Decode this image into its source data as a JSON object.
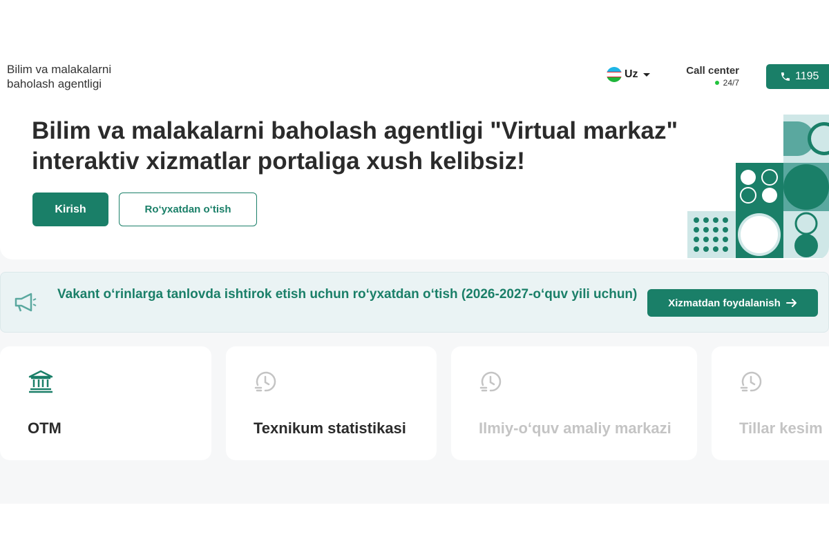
{
  "header": {
    "brand_line1": "Bilim va malakalarni",
    "brand_line2": "baholash agentligi",
    "language": "Uz",
    "call_center_title": "Call center",
    "call_center_hours": "24/7",
    "phone_number": "1195"
  },
  "hero": {
    "title_line1": "Bilim va malakalarni baholash agentligi \"Virtual markaz\"",
    "title_line2": "interaktiv xizmatlar portaliga xush kelibsiz!",
    "login_label": "Kirish",
    "register_label": "Ro‘yxatdan o‘tish"
  },
  "banner": {
    "text": "Vakant o‘rinlarga tanlovda ishtirok etish uchun ro‘yxatdan o‘tish (2026-2027-o‘quv yili uchun)",
    "button_label": "Xizmatdan foydalanish",
    "icon": "megaphone-icon"
  },
  "cards": [
    {
      "label": "OTM",
      "icon": "university-building-icon",
      "state": "active"
    },
    {
      "label": "Texnikum statistikasi",
      "icon": "clock-icon",
      "state": "active"
    },
    {
      "label": "Ilmiy-o‘quv amaliy markazi",
      "icon": "clock-icon",
      "state": "disabled"
    },
    {
      "label": "Tillar kesim",
      "icon": "clock-icon",
      "state": "disabled"
    }
  ],
  "colors": {
    "primary": "#1a7f68",
    "banner_bg": "#eaf3f4",
    "page_bg": "#f6f7f8",
    "disabled_text": "#c4c4c4"
  }
}
